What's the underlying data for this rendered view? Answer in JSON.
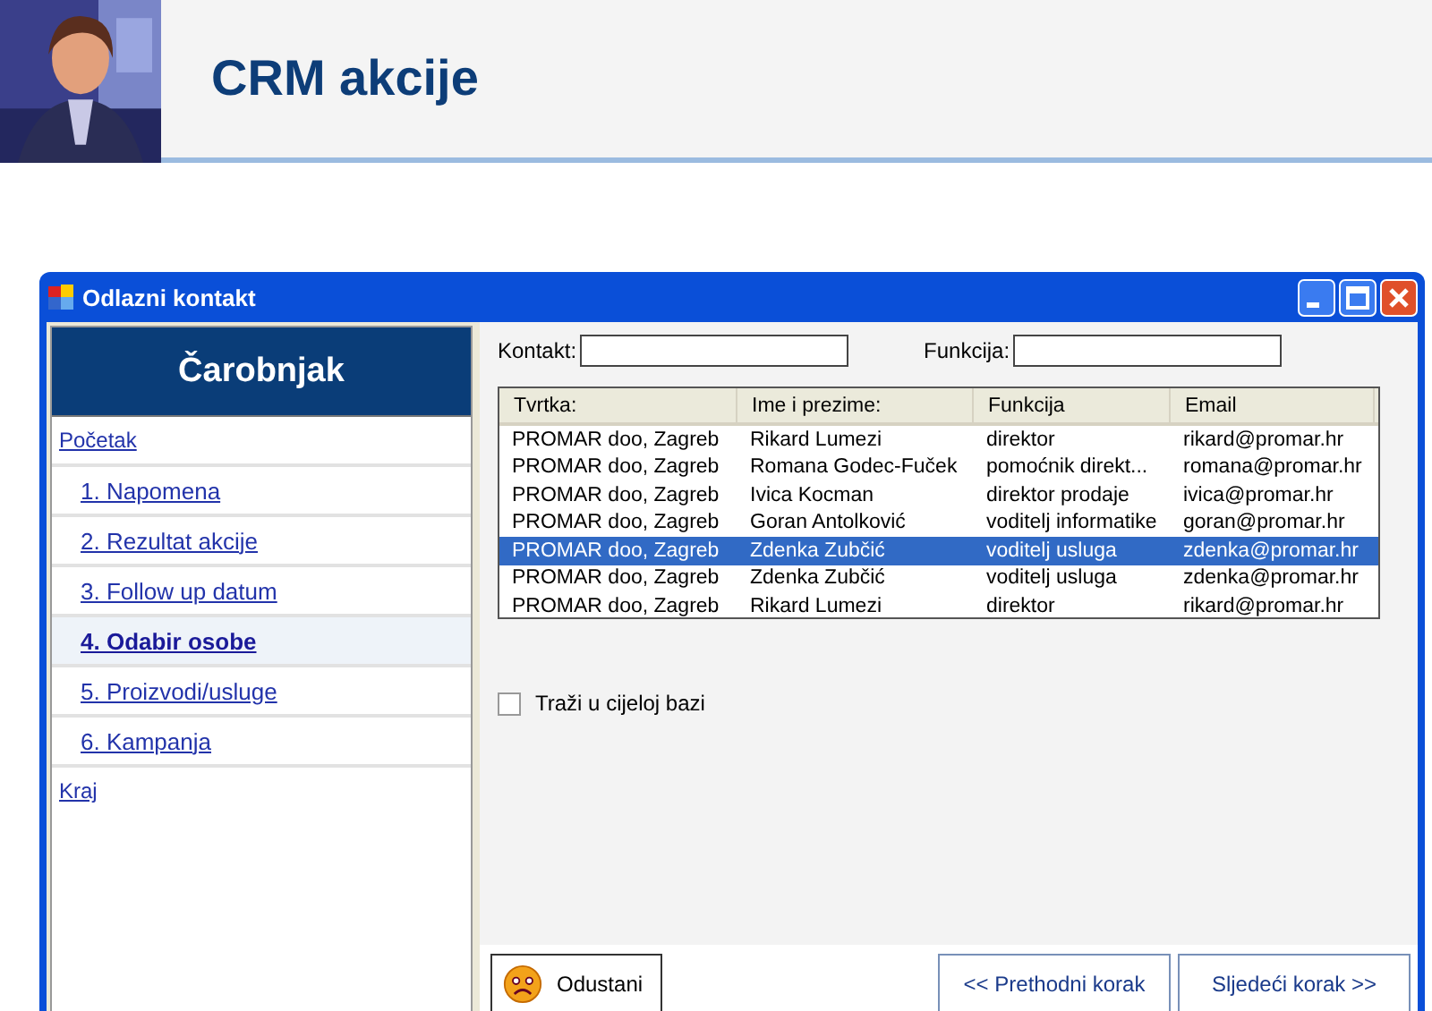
{
  "slide": {
    "title": "CRM akcije"
  },
  "window": {
    "title": "Odlazni kontakt"
  },
  "sidebar": {
    "header": "Čarobnjak",
    "items": [
      {
        "label": "Početak",
        "selected": false,
        "children": [
          {
            "label": "1. Napomena",
            "selected": false
          },
          {
            "label": "2. Rezultat akcije",
            "selected": false
          },
          {
            "label": "3. Follow up datum",
            "selected": false
          },
          {
            "label": "4. Odabir osobe",
            "selected": true
          },
          {
            "label": "5. Proizvodi/usluge",
            "selected": false
          },
          {
            "label": "6. Kampanja",
            "selected": false
          }
        ]
      },
      {
        "label": "Kraj",
        "selected": false
      }
    ]
  },
  "filters": [
    {
      "label": "Kontakt:"
    },
    {
      "label": "Funkcija:"
    }
  ],
  "table": {
    "columns": [
      "Tvrtka:",
      "Ime i prezime:",
      "Funkcija",
      "Email"
    ],
    "rows": [
      {
        "cells": [
          "PROMAR doo, Zagreb",
          "Rikard Lumezi",
          "direktor",
          "rikard@promar.hr"
        ],
        "selected": false
      },
      {
        "cells": [
          "PROMAR doo, Zagreb",
          "Romana Godec-Fuček",
          "pomoćnik direkt...",
          "romana@promar.hr"
        ],
        "selected": false
      },
      {
        "cells": [
          "PROMAR doo, Zagreb",
          "Ivica Kocman",
          "direktor prodaje",
          "ivica@promar.hr"
        ],
        "selected": false
      },
      {
        "cells": [
          "PROMAR doo, Zagreb",
          "Goran Antolković",
          "voditelj informatike",
          "goran@promar.hr"
        ],
        "selected": false
      },
      {
        "cells": [
          "PROMAR doo, Zagreb",
          "Zdenka Zubčić",
          "voditelj usluga",
          "zdenka@promar.hr"
        ],
        "selected": true
      },
      {
        "cells": [
          "PROMAR doo, Zagreb",
          "Zdenka Zubčić",
          "voditelj usluga",
          "zdenka@promar.hr"
        ],
        "selected": false
      },
      {
        "cells": [
          "PROMAR doo, Zagreb",
          "Rikard Lumezi",
          "direktor",
          "rikard@promar.hr"
        ],
        "selected": false
      }
    ]
  },
  "search_all": {
    "label": "Traži u cijeloj bazi",
    "checked": false
  },
  "buttons": {
    "cancel": "Odustani",
    "previous": "<< Prethodni korak",
    "next": "Sljedeći korak >>"
  }
}
